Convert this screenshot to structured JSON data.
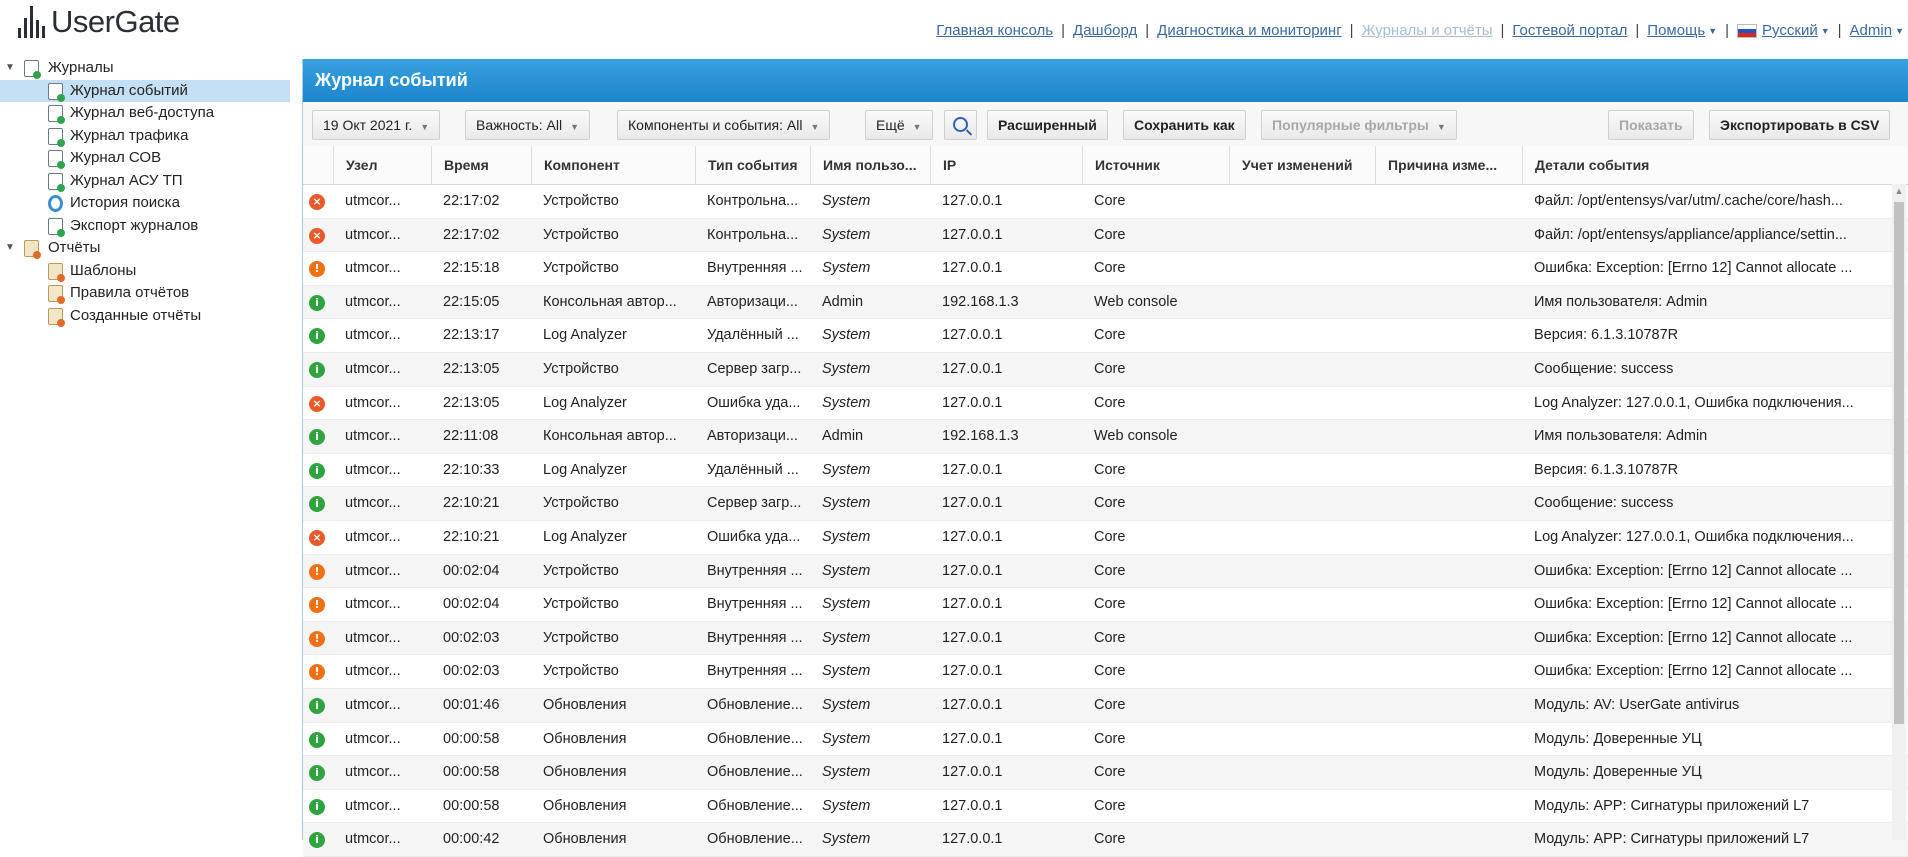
{
  "app": {
    "logo_text": "UserGate"
  },
  "topnav": [
    {
      "label": "Главная консоль",
      "disabled": false,
      "dropdown": false
    },
    {
      "label": "Дашборд",
      "disabled": false,
      "dropdown": false
    },
    {
      "label": "Диагностика и мониторинг",
      "disabled": false,
      "dropdown": false
    },
    {
      "label": "Журналы и отчёты",
      "disabled": true,
      "dropdown": false
    },
    {
      "label": "Гостевой портал",
      "disabled": false,
      "dropdown": false
    },
    {
      "label": "Помощь",
      "disabled": false,
      "dropdown": true
    },
    {
      "label": "Русский",
      "disabled": false,
      "dropdown": true,
      "flag": true
    },
    {
      "label": "Admin",
      "disabled": false,
      "dropdown": true
    }
  ],
  "sidebar": {
    "groups": [
      {
        "label": "Журналы",
        "icon": "logs-group-icon",
        "items": [
          {
            "label": "Журнал событий",
            "icon": "event-log-icon",
            "selected": true
          },
          {
            "label": "Журнал веб-доступа",
            "icon": "web-access-log-icon"
          },
          {
            "label": "Журнал трафика",
            "icon": "traffic-log-icon"
          },
          {
            "label": "Журнал СОВ",
            "icon": "ids-log-icon"
          },
          {
            "label": "Журнал АСУ ТП",
            "icon": "scada-log-icon"
          },
          {
            "label": "История поиска",
            "icon": "search-history-icon"
          },
          {
            "label": "Экспорт журналов",
            "icon": "log-export-icon"
          }
        ]
      },
      {
        "label": "Отчёты",
        "icon": "reports-group-icon",
        "items": [
          {
            "label": "Шаблоны",
            "icon": "templates-icon"
          },
          {
            "label": "Правила отчётов",
            "icon": "report-rules-icon"
          },
          {
            "label": "Созданные отчёты",
            "icon": "created-reports-icon"
          }
        ]
      }
    ]
  },
  "panel": {
    "title": "Журнал событий"
  },
  "toolbar": {
    "date": "19 Окт 2021 г.",
    "severity": "Важность: All",
    "components": "Компоненты и события: All",
    "more": "Ещё",
    "advanced": "Расширенный",
    "save_as": "Сохранить как",
    "popular_filters": "Популярные фильтры",
    "show": "Показать",
    "export_csv": "Экспортировать в CSV"
  },
  "columns": [
    "Узел",
    "Время",
    "Компонент",
    "Тип события",
    "Имя пользо...",
    "IP",
    "Источник",
    "Учет изменений",
    "Причина изме...",
    "Детали события"
  ],
  "rows": [
    {
      "sev": "error",
      "node": "utmcor...",
      "time": "22:17:02",
      "component": "Устройство",
      "type": "Контрольна...",
      "user": "System",
      "ip": "127.0.0.1",
      "source": "Core",
      "changes": "",
      "reason": "",
      "details": "Файл: /opt/entensys/var/utm/.cache/core/hash..."
    },
    {
      "sev": "error",
      "node": "utmcor...",
      "time": "22:17:02",
      "component": "Устройство",
      "type": "Контрольна...",
      "user": "System",
      "ip": "127.0.0.1",
      "source": "Core",
      "changes": "",
      "reason": "",
      "details": "Файл: /opt/entensys/appliance/appliance/settin..."
    },
    {
      "sev": "warning",
      "node": "utmcor...",
      "time": "22:15:18",
      "component": "Устройство",
      "type": "Внутренняя ...",
      "user": "System",
      "ip": "127.0.0.1",
      "source": "Core",
      "changes": "",
      "reason": "",
      "details": "Ошибка: Exception: [Errno 12] Cannot allocate ..."
    },
    {
      "sev": "info",
      "node": "utmcor...",
      "time": "22:15:05",
      "component": "Консольная автор...",
      "type": "Авторизаци...",
      "user": "Admin",
      "ip": "192.168.1.3",
      "source": "Web console",
      "changes": "",
      "reason": "",
      "details": "Имя пользователя: Admin"
    },
    {
      "sev": "info",
      "node": "utmcor...",
      "time": "22:13:17",
      "component": "Log Analyzer",
      "type": "Удалённый ...",
      "user": "System",
      "ip": "127.0.0.1",
      "source": "Core",
      "changes": "",
      "reason": "",
      "details": "Версия: 6.1.3.10787R"
    },
    {
      "sev": "info",
      "node": "utmcor...",
      "time": "22:13:05",
      "component": "Устройство",
      "type": "Сервер загр...",
      "user": "System",
      "ip": "127.0.0.1",
      "source": "Core",
      "changes": "",
      "reason": "",
      "details": "Сообщение: success"
    },
    {
      "sev": "error",
      "node": "utmcor...",
      "time": "22:13:05",
      "component": "Log Analyzer",
      "type": "Ошибка уда...",
      "user": "System",
      "ip": "127.0.0.1",
      "source": "Core",
      "changes": "",
      "reason": "",
      "details": "Log Analyzer: 127.0.0.1, Ошибка подключения..."
    },
    {
      "sev": "info",
      "node": "utmcor...",
      "time": "22:11:08",
      "component": "Консольная автор...",
      "type": "Авторизаци...",
      "user": "Admin",
      "ip": "192.168.1.3",
      "source": "Web console",
      "changes": "",
      "reason": "",
      "details": "Имя пользователя: Admin"
    },
    {
      "sev": "info",
      "node": "utmcor...",
      "time": "22:10:33",
      "component": "Log Analyzer",
      "type": "Удалённый ...",
      "user": "System",
      "ip": "127.0.0.1",
      "source": "Core",
      "changes": "",
      "reason": "",
      "details": "Версия: 6.1.3.10787R"
    },
    {
      "sev": "info",
      "node": "utmcor...",
      "time": "22:10:21",
      "component": "Устройство",
      "type": "Сервер загр...",
      "user": "System",
      "ip": "127.0.0.1",
      "source": "Core",
      "changes": "",
      "reason": "",
      "details": "Сообщение: success"
    },
    {
      "sev": "error",
      "node": "utmcor...",
      "time": "22:10:21",
      "component": "Log Analyzer",
      "type": "Ошибка уда...",
      "user": "System",
      "ip": "127.0.0.1",
      "source": "Core",
      "changes": "",
      "reason": "",
      "details": "Log Analyzer: 127.0.0.1, Ошибка подключения..."
    },
    {
      "sev": "warning",
      "node": "utmcor...",
      "time": "00:02:04",
      "component": "Устройство",
      "type": "Внутренняя ...",
      "user": "System",
      "ip": "127.0.0.1",
      "source": "Core",
      "changes": "",
      "reason": "",
      "details": "Ошибка: Exception: [Errno 12] Cannot allocate ..."
    },
    {
      "sev": "warning",
      "node": "utmcor...",
      "time": "00:02:04",
      "component": "Устройство",
      "type": "Внутренняя ...",
      "user": "System",
      "ip": "127.0.0.1",
      "source": "Core",
      "changes": "",
      "reason": "",
      "details": "Ошибка: Exception: [Errno 12] Cannot allocate ..."
    },
    {
      "sev": "warning",
      "node": "utmcor...",
      "time": "00:02:03",
      "component": "Устройство",
      "type": "Внутренняя ...",
      "user": "System",
      "ip": "127.0.0.1",
      "source": "Core",
      "changes": "",
      "reason": "",
      "details": "Ошибка: Exception: [Errno 12] Cannot allocate ..."
    },
    {
      "sev": "warning",
      "node": "utmcor...",
      "time": "00:02:03",
      "component": "Устройство",
      "type": "Внутренняя ...",
      "user": "System",
      "ip": "127.0.0.1",
      "source": "Core",
      "changes": "",
      "reason": "",
      "details": "Ошибка: Exception: [Errno 12] Cannot allocate ..."
    },
    {
      "sev": "info",
      "node": "utmcor...",
      "time": "00:01:46",
      "component": "Обновления",
      "type": "Обновление...",
      "user": "System",
      "ip": "127.0.0.1",
      "source": "Core",
      "changes": "",
      "reason": "",
      "details": "Модуль: AV: UserGate antivirus"
    },
    {
      "sev": "info",
      "node": "utmcor...",
      "time": "00:00:58",
      "component": "Обновления",
      "type": "Обновление...",
      "user": "System",
      "ip": "127.0.0.1",
      "source": "Core",
      "changes": "",
      "reason": "",
      "details": "Модуль: Доверенные УЦ"
    },
    {
      "sev": "info",
      "node": "utmcor...",
      "time": "00:00:58",
      "component": "Обновления",
      "type": "Обновление...",
      "user": "System",
      "ip": "127.0.0.1",
      "source": "Core",
      "changes": "",
      "reason": "",
      "details": "Модуль: Доверенные УЦ"
    },
    {
      "sev": "info",
      "node": "utmcor...",
      "time": "00:00:58",
      "component": "Обновления",
      "type": "Обновление...",
      "user": "System",
      "ip": "127.0.0.1",
      "source": "Core",
      "changes": "",
      "reason": "",
      "details": "Модуль: APP: Сигнатуры приложений L7"
    },
    {
      "sev": "info",
      "node": "utmcor...",
      "time": "00:00:42",
      "component": "Обновления",
      "type": "Обновление...",
      "user": "System",
      "ip": "127.0.0.1",
      "source": "Core",
      "changes": "",
      "reason": "",
      "details": "Модуль: APP: Сигнатуры приложений L7"
    }
  ],
  "colors": {
    "accent": "#1e86cb",
    "selected": "#c5e0f5",
    "info": "#2fa33f",
    "error": "#ea5a2a",
    "warning": "#f07015"
  }
}
